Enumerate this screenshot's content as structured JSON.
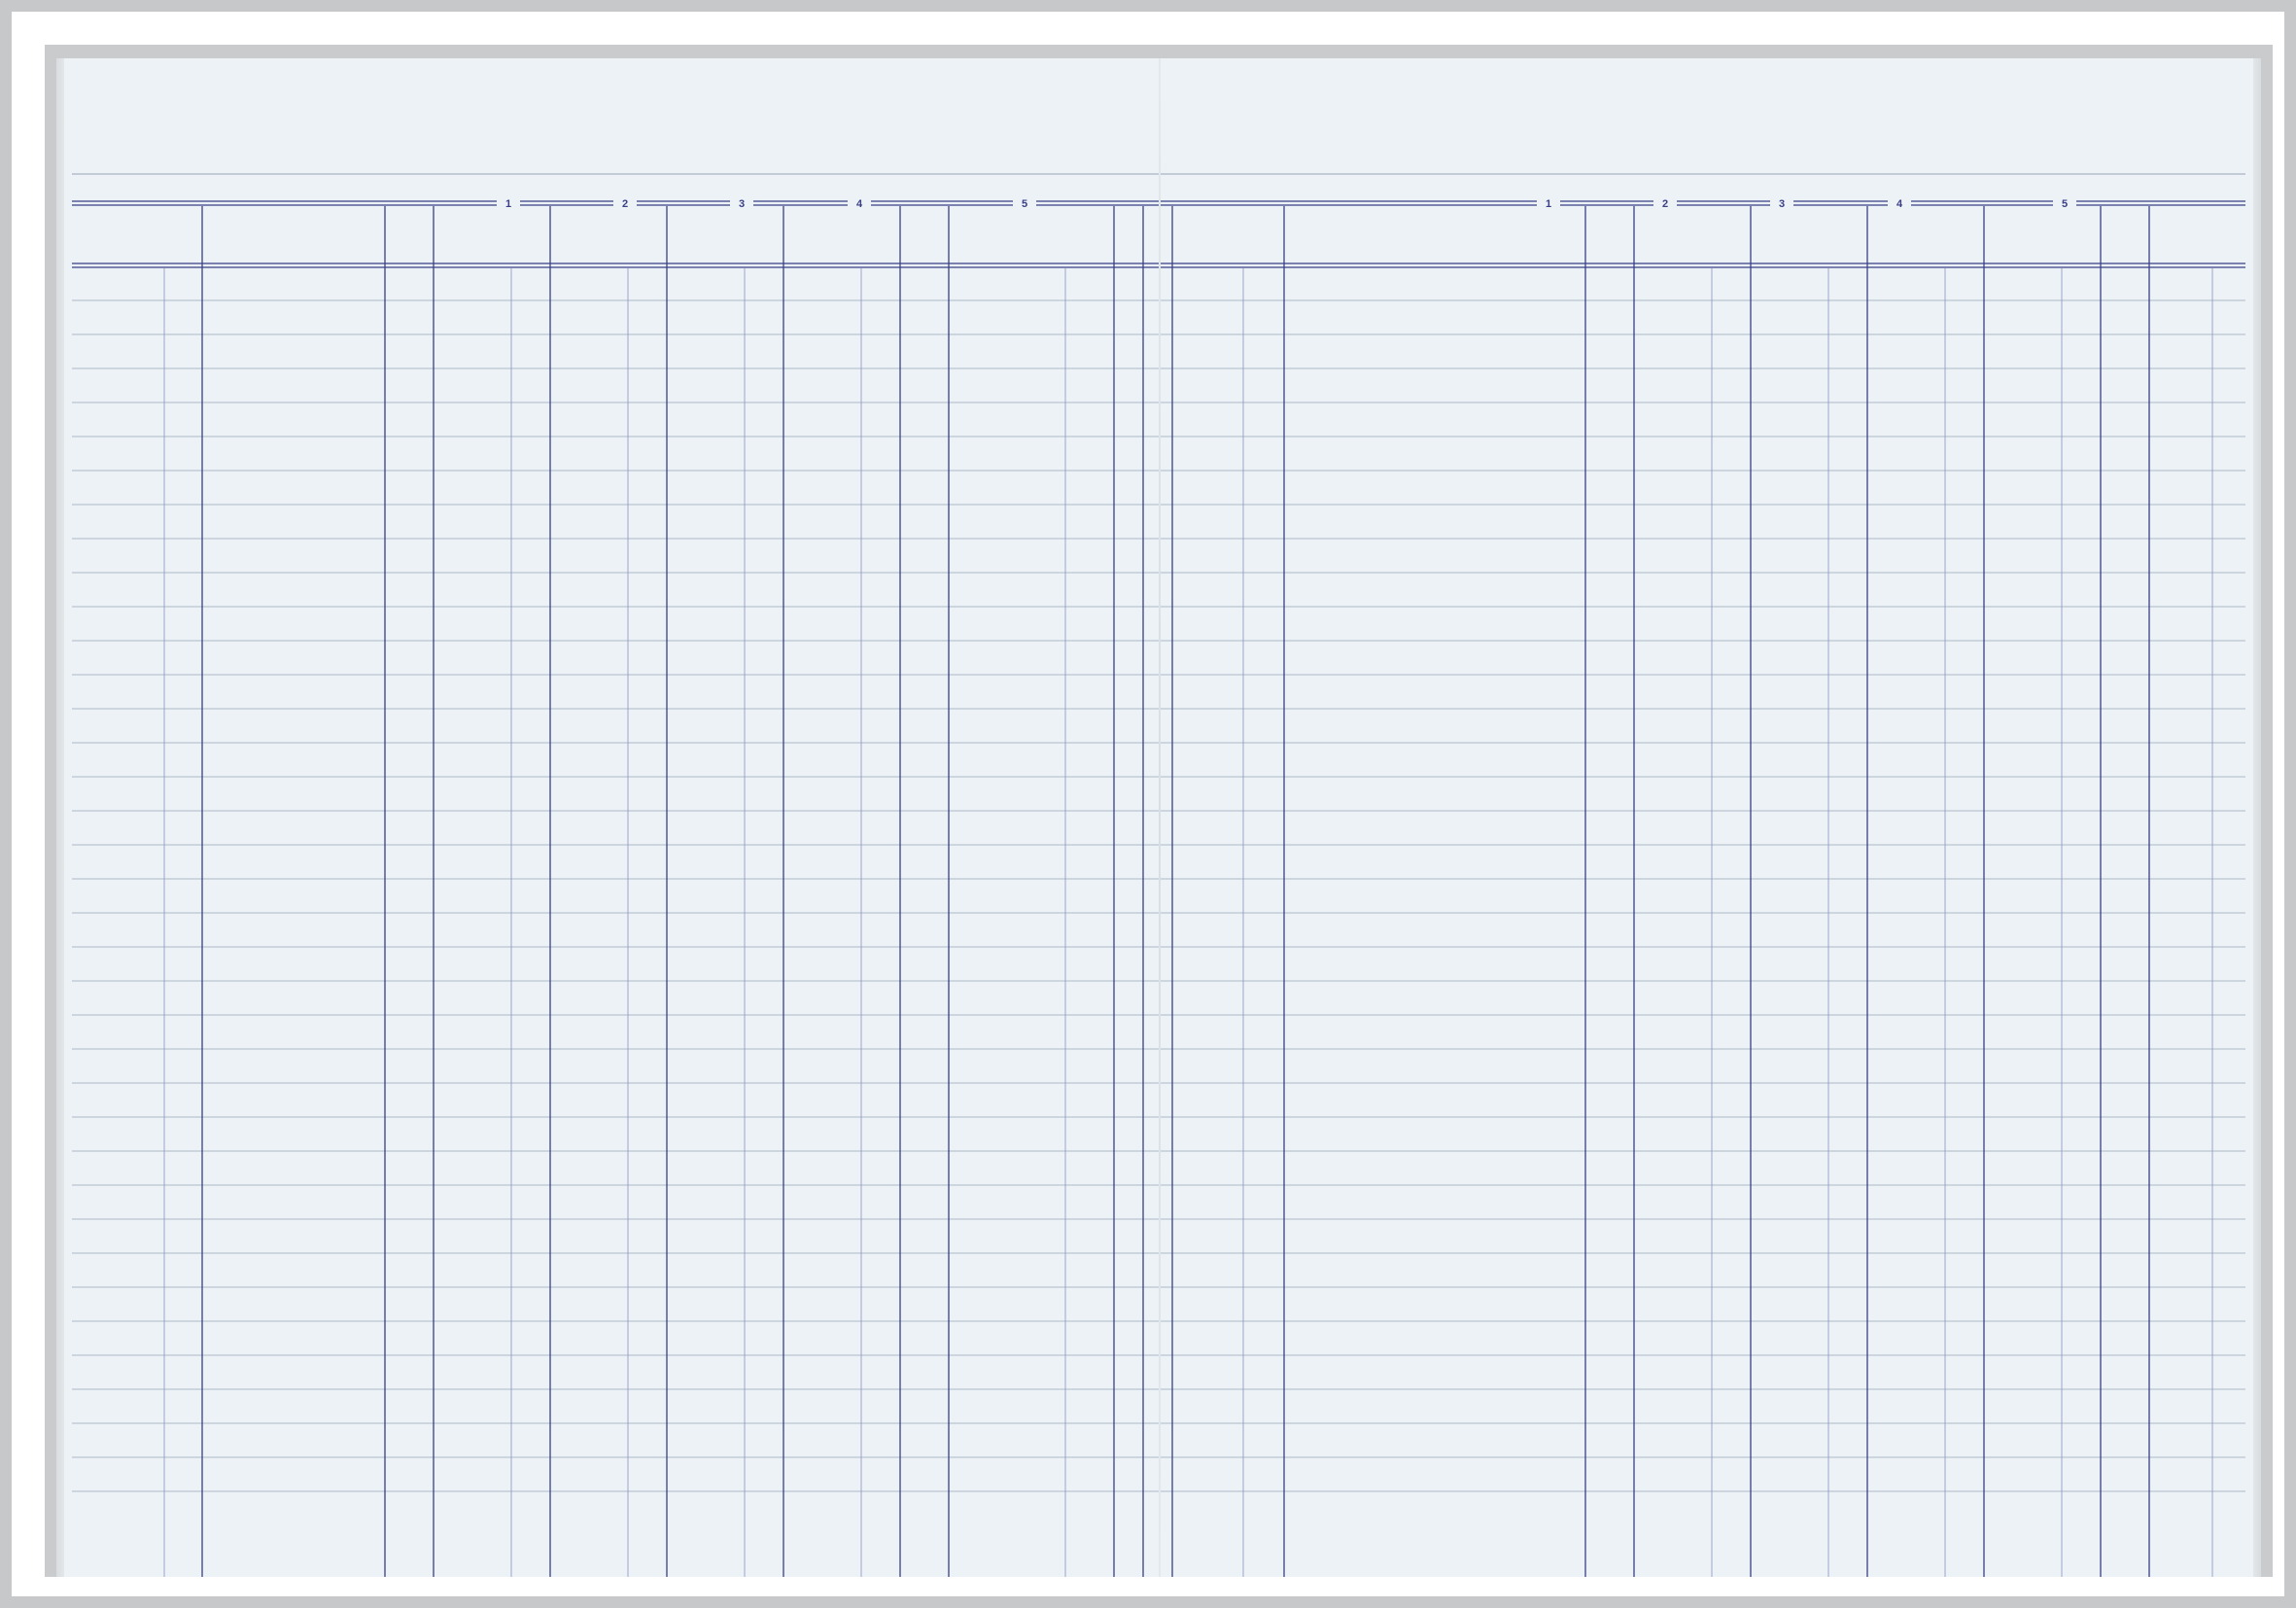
{
  "ledger": {
    "left_page": {
      "column_numbers": [
        "1",
        "2",
        "3",
        "4",
        "5"
      ]
    },
    "right_page": {
      "column_numbers": [
        "1",
        "2",
        "3",
        "4",
        "5"
      ]
    },
    "row_count": 36,
    "colors": {
      "major_rule": "#3a3f86",
      "minor_rule": "#8b93c4",
      "row_rule": "#9aa6b8",
      "paper": "#ecf2f5",
      "frame": "#c6c8ca"
    }
  }
}
